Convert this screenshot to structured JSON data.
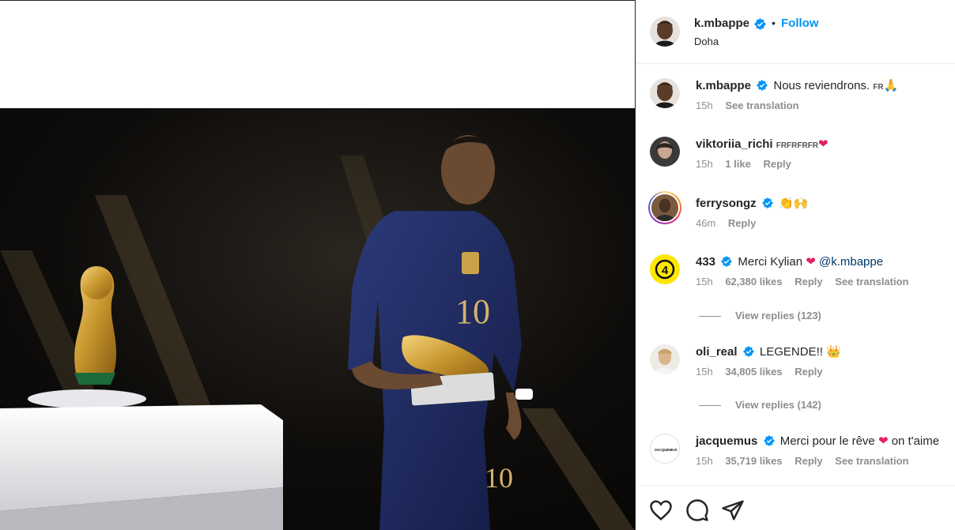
{
  "post": {
    "author": "k.mbappe",
    "separator": "•",
    "follow_label": "Follow",
    "location": "Doha",
    "image_icon": "photo-world-cup-player-golden-boot"
  },
  "comments": [
    {
      "user": "k.mbappe",
      "verified": true,
      "text": "Nous reviendrons.",
      "flag": "FR",
      "emoji": "🙏",
      "time": "15h",
      "likes": "",
      "reply": "",
      "translate": "See translation"
    },
    {
      "user": "viktoriia_richi",
      "verified": false,
      "text": "",
      "flag": "FRFRFRFR",
      "emoji": "❤",
      "time": "15h",
      "likes": "1 like",
      "reply": "Reply",
      "translate": ""
    },
    {
      "user": "ferrysongz",
      "verified": true,
      "text": "",
      "flag": "",
      "emoji": "👏🙌",
      "time": "46m",
      "likes": "",
      "reply": "Reply",
      "translate": ""
    },
    {
      "user": "433",
      "verified": true,
      "text": "Merci Kylian",
      "flag": "",
      "emoji": "❤",
      "mention": "@k.mbappe",
      "time": "15h",
      "likes": "62,380 likes",
      "reply": "Reply",
      "translate": "See translation",
      "view_replies": "View replies (123)"
    },
    {
      "user": "oli_real",
      "verified": true,
      "text": "LEGENDE!!",
      "flag": "",
      "emoji": "👑",
      "time": "15h",
      "likes": "34,805 likes",
      "reply": "Reply",
      "translate": "",
      "view_replies": "View replies (142)"
    },
    {
      "user": "jacquemus",
      "verified": true,
      "text": "Merci pour le rêve",
      "flag": "",
      "emoji": "❤",
      "text2": "on t'aime",
      "time": "15h",
      "likes": "35,719 likes",
      "reply": "Reply",
      "translate": "See translation"
    }
  ],
  "jacquemus_logo_text": "JACQUEMUS",
  "badge_433": "4",
  "actions": [
    "heart-icon",
    "comment-icon",
    "share-icon"
  ],
  "colors": {
    "accent": "#0095f6",
    "verified": "#0095f6",
    "heart": "#e0245e"
  }
}
